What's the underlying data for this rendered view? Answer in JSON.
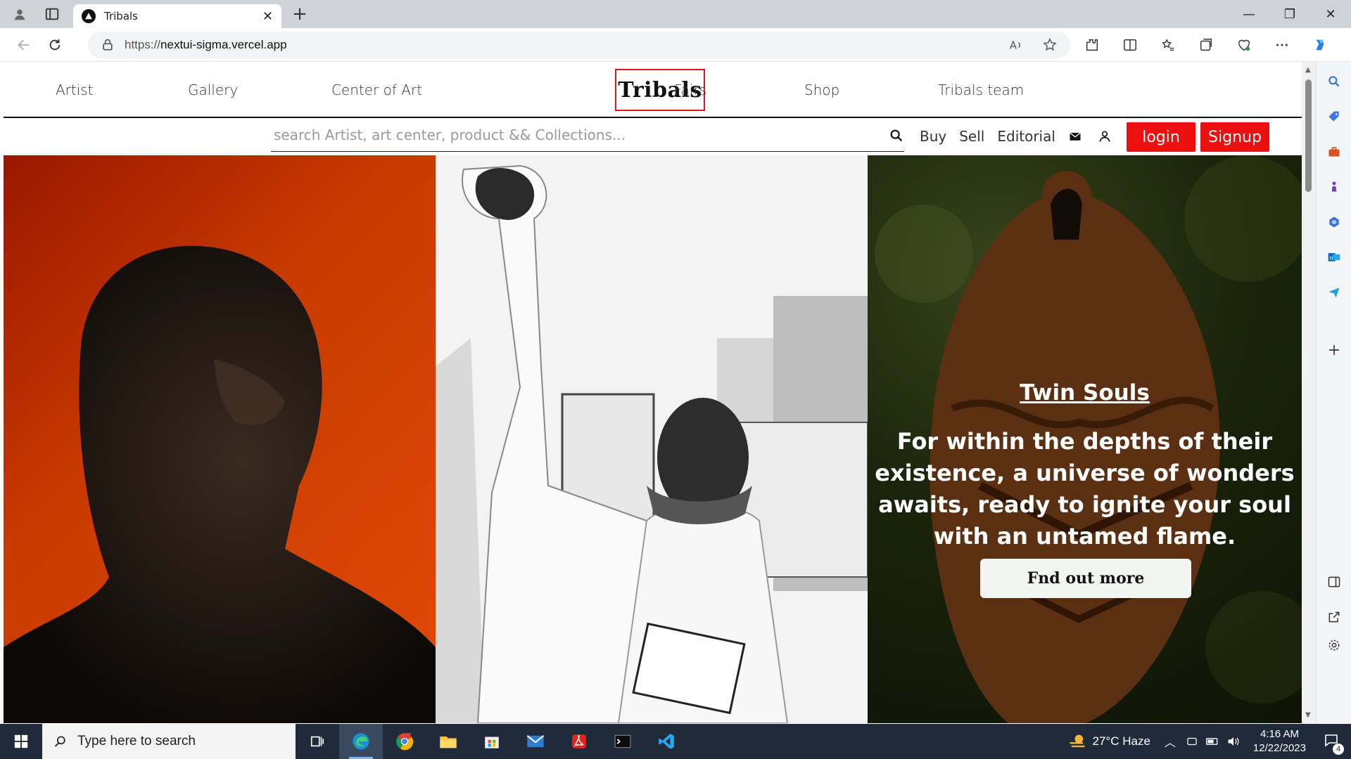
{
  "browser": {
    "tab_title": "Tribals",
    "url_prefix": "https://",
    "url_host": "nextui-sigma.vercel.app"
  },
  "site": {
    "logo": "Tribals",
    "nav_left": [
      "Artist",
      "Gallery",
      "Center of Art"
    ],
    "nav_right": [
      "Fairs",
      "Shop",
      "Tribals team"
    ],
    "search_placeholder": "search Artist, art center, product && Collections...",
    "sub_links": [
      "Buy",
      "Sell",
      "Editorial"
    ],
    "login_label": "login",
    "signup_label": "Signup",
    "accent_color": "#ee1010"
  },
  "hero": {
    "title": "Twin Souls",
    "body": "For within the depths of their existence, a universe of wonders awaits, ready to ignite your soul with an untamed flame.",
    "button_label": "Fnd out more"
  },
  "taskbar": {
    "search_placeholder": "Type here to search",
    "weather": "27°C  Haze",
    "time": "4:16 AM",
    "date": "12/22/2023",
    "notification_count": "4"
  }
}
